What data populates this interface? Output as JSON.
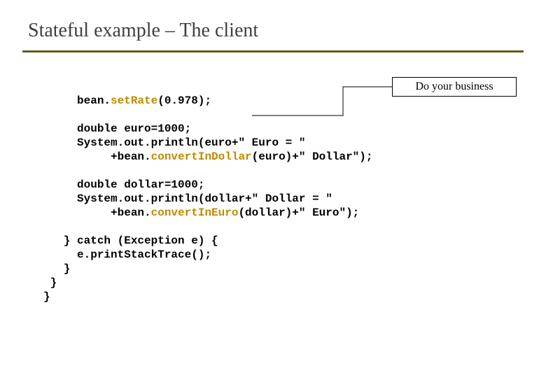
{
  "title": "Stateful example – The client",
  "callout": "Do your business",
  "code": {
    "l1a": "     bean.",
    "l1b": "setRate",
    "l1c": "(0.978);",
    "l2": "",
    "l3": "     double euro=1000;",
    "l4": "     System.out.println(euro+\" Euro = \"",
    "l5a": "          +bean.",
    "l5b": "convertInDollar",
    "l5c": "(euro)+\" Dollar\");",
    "l6": "",
    "l7": "     double dollar=1000;",
    "l8": "     System.out.println(dollar+\" Dollar = \"",
    "l9a": "          +bean.",
    "l9b": "convertInEuro",
    "l9c": "(dollar)+\" Euro\");",
    "l10": "",
    "l11": "   } catch (Exception e) {",
    "l12": "     e.printStackTrace();",
    "l13": "   }",
    "l14": " }",
    "l15": "}"
  }
}
